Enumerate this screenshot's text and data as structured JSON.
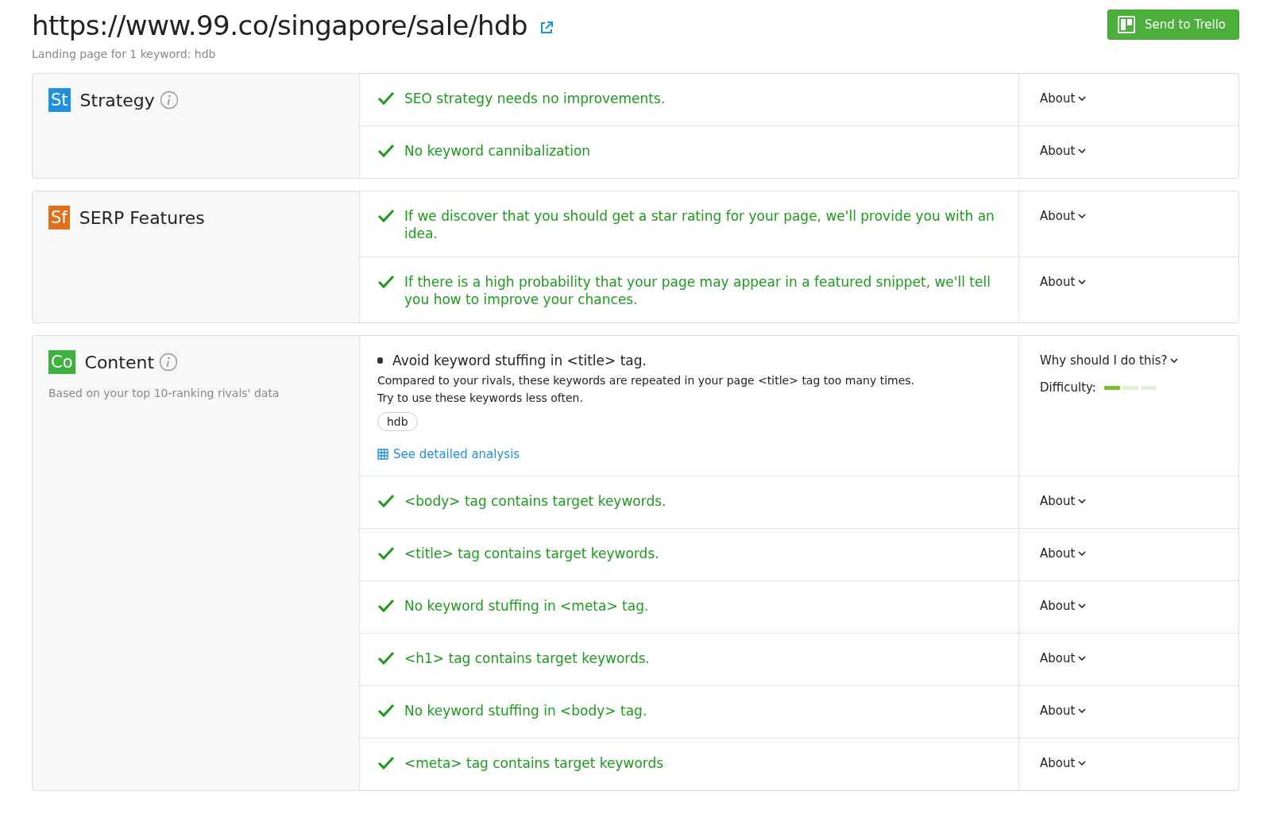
{
  "header": {
    "url": "https://www.99.co/singapore/sale/hdb",
    "subtitle": "Landing page for 1 keyword: hdb",
    "trello_button": "Send to Trello"
  },
  "sections": [
    {
      "badge": "St",
      "color": "#1e8fe1",
      "title": "Strategy",
      "info": true,
      "items": [
        {
          "kind": "ok",
          "text": "SEO strategy needs no improvements.",
          "toggle": "About"
        },
        {
          "kind": "ok",
          "text": "No keyword cannibalization",
          "toggle": "About"
        }
      ]
    },
    {
      "badge": "Sf",
      "color": "#e0701a",
      "title": "SERP Features",
      "info": false,
      "items": [
        {
          "kind": "ok",
          "text": "If we discover that you should get a star rating for your page, we'll provide you with an idea.",
          "toggle": "About"
        },
        {
          "kind": "ok",
          "text": "If there is a high probability that your page may appear in a featured snippet, we'll tell you how to improve your chances.",
          "toggle": "About"
        }
      ]
    },
    {
      "badge": "Co",
      "color": "#3eb13e",
      "title": "Content",
      "info": true,
      "note": "Based on your top 10-ranking rivals' data",
      "items": [
        {
          "kind": "task",
          "text": "Avoid keyword stuffing in <title> tag.",
          "details": [
            "Compared to your rivals, these keywords are repeated in your page <title> tag too many times.",
            "Try to use these keywords less often."
          ],
          "tags": [
            "hdb"
          ],
          "link": "See detailed analysis",
          "toggle": "Why should I do this?",
          "difficulty_label": "Difficulty:",
          "level": 0.33
        },
        {
          "kind": "ok",
          "text": "<body> tag contains target keywords.",
          "toggle": "About"
        },
        {
          "kind": "ok",
          "text": "<title> tag contains target keywords.",
          "toggle": "About"
        },
        {
          "kind": "ok",
          "text": "No keyword stuffing in <meta> tag.",
          "toggle": "About"
        },
        {
          "kind": "ok",
          "text": "<h1> tag contains target keywords.",
          "toggle": "About"
        },
        {
          "kind": "ok",
          "text": "No keyword stuffing in <body> tag.",
          "toggle": "About"
        },
        {
          "kind": "ok",
          "text": "<meta> tag contains target keywords",
          "toggle": "About"
        }
      ]
    }
  ]
}
